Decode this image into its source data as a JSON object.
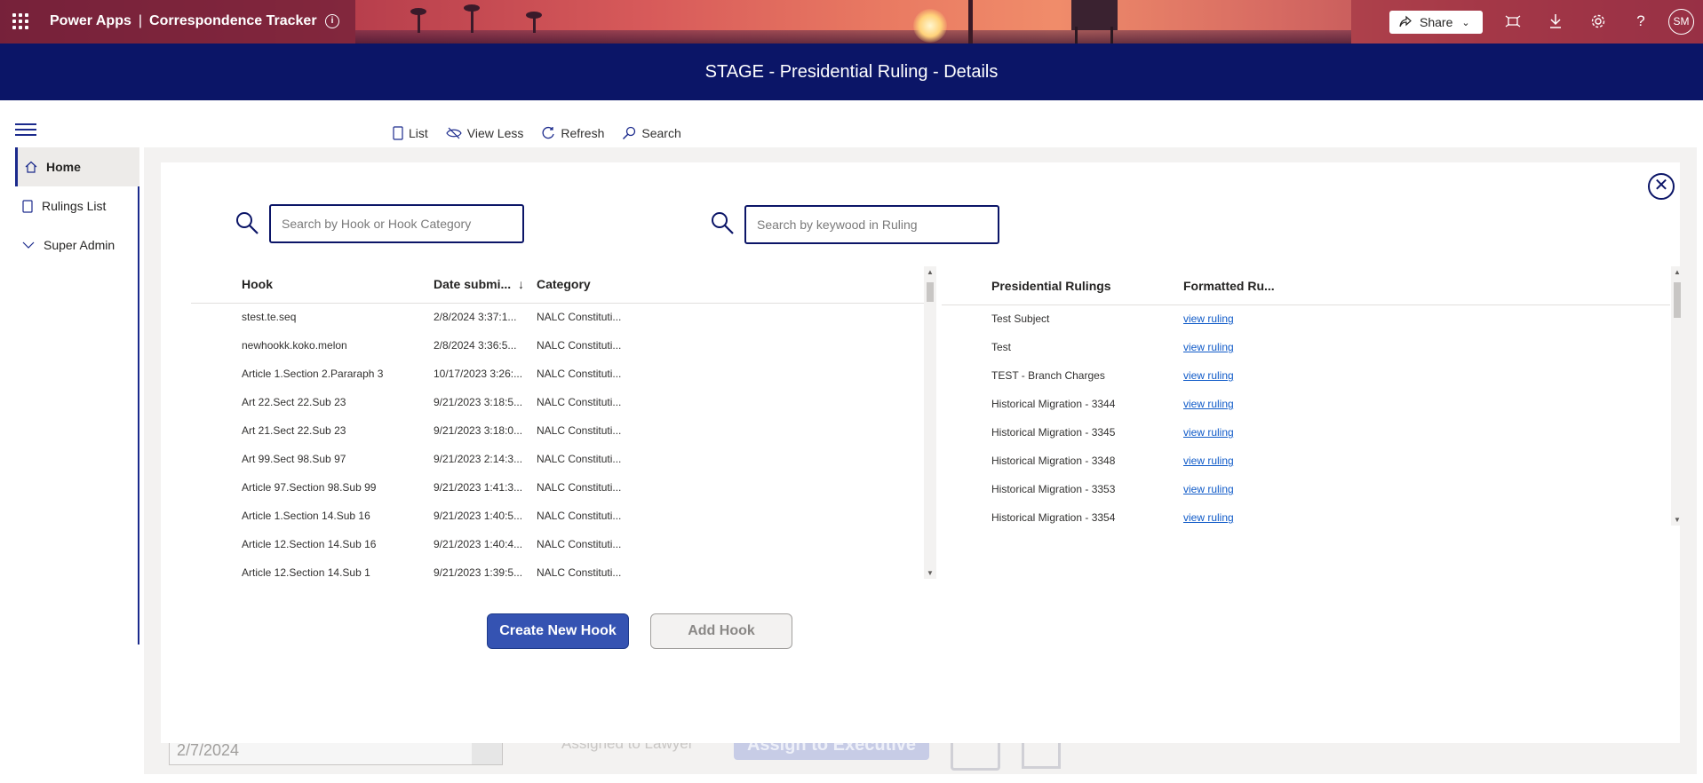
{
  "header": {
    "brand_left": "Power Apps",
    "brand_sep": "|",
    "brand_right": "Correspondence Tracker",
    "share_label": "Share",
    "avatar_initials": "SM"
  },
  "banner": {
    "title": "STAGE - Presidential Ruling - Details"
  },
  "sidebar": {
    "items": [
      {
        "label": "Home",
        "icon": "home-icon",
        "active": true
      },
      {
        "label": "Rulings List",
        "icon": "list-icon"
      },
      {
        "label": "Super Admin",
        "icon": "chevron-down-icon"
      }
    ]
  },
  "commandbar": {
    "list": "List",
    "view_less": "View Less",
    "refresh": "Refresh",
    "search": "Search"
  },
  "search": {
    "hook_placeholder": "Search by Hook or Hook Category",
    "ruling_placeholder": "Search by keywood in Ruling"
  },
  "hooks_table": {
    "headers": {
      "hook": "Hook",
      "date": "Date submi...",
      "sort": "↓",
      "category": "Category"
    },
    "rows": [
      {
        "hook": "stest.te.seq",
        "date": "2/8/2024 3:37:1...",
        "category": "NALC Constituti..."
      },
      {
        "hook": "newhookk.koko.melon",
        "date": "2/8/2024 3:36:5...",
        "category": "NALC Constituti..."
      },
      {
        "hook": "Article 1.Section 2.Pararaph 3",
        "date": "10/17/2023 3:26:...",
        "category": "NALC Constituti..."
      },
      {
        "hook": "Art 22.Sect 22.Sub 23",
        "date": "9/21/2023 3:18:5...",
        "category": "NALC Constituti..."
      },
      {
        "hook": "Art 21.Sect 22.Sub 23",
        "date": "9/21/2023 3:18:0...",
        "category": "NALC Constituti..."
      },
      {
        "hook": "Art 99.Sect 98.Sub 97",
        "date": "9/21/2023 2:14:3...",
        "category": "NALC Constituti..."
      },
      {
        "hook": "Article 97.Section 98.Sub 99",
        "date": "9/21/2023 1:41:3...",
        "category": "NALC Constituti..."
      },
      {
        "hook": "Article 1.Section 14.Sub 16",
        "date": "9/21/2023 1:40:5...",
        "category": "NALC Constituti..."
      },
      {
        "hook": "Article 12.Section 14.Sub 16",
        "date": "9/21/2023 1:40:4...",
        "category": "NALC Constituti..."
      },
      {
        "hook": "Article 12.Section 14.Sub 1",
        "date": "9/21/2023 1:39:5...",
        "category": "NALC Constituti..."
      }
    ]
  },
  "rulings_table": {
    "headers": {
      "ruling": "Presidential Rulings",
      "formatted": "Formatted Ru..."
    },
    "link_label": "view ruling",
    "rows": [
      {
        "ruling": "Test Subject"
      },
      {
        "ruling": "Test"
      },
      {
        "ruling": "TEST - Branch Charges"
      },
      {
        "ruling": "Historical Migration - 3344"
      },
      {
        "ruling": "Historical Migration - 3345"
      },
      {
        "ruling": "Historical Migration - 3348"
      },
      {
        "ruling": "Historical Migration - 3353"
      },
      {
        "ruling": "Historical Migration - 3354"
      }
    ]
  },
  "buttons": {
    "create_hook": "Create New Hook",
    "add_hook": "Add Hook"
  },
  "background_form": {
    "date_value": "2/7/2024",
    "assigned_label": "Assigned to Lawyer",
    "assign_button": "Assign to Executive"
  },
  "colors": {
    "banner": "#0b1567",
    "primary_button": "#3553b2",
    "link": "#0f5ac8",
    "accent": "#1b2a8c"
  }
}
